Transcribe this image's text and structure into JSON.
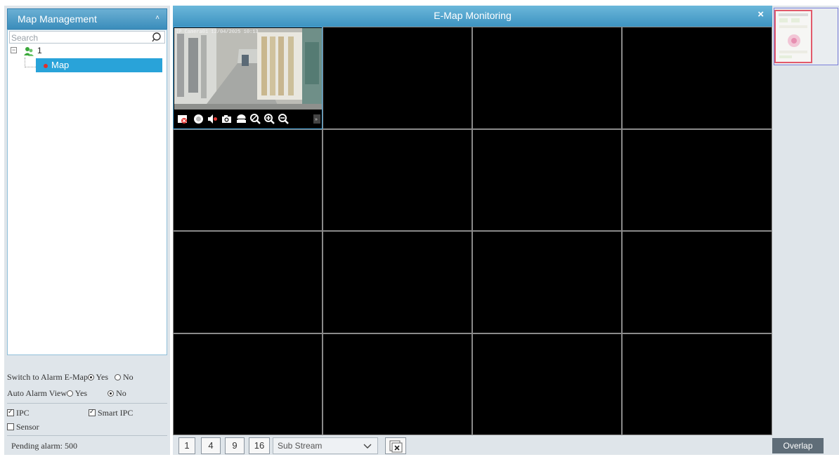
{
  "left_panel": {
    "title": "Map Management",
    "search": {
      "placeholder": "Search"
    },
    "tree": {
      "root_label": "1",
      "expander": "⊟",
      "children": [
        {
          "label": "Map",
          "selected": true
        }
      ]
    },
    "options": {
      "switch_alarm_label": "Switch to Alarm E-Map",
      "switch_alarm_yes": "Yes",
      "switch_alarm_no": "No",
      "switch_alarm_selected": "Yes",
      "auto_alarm_label": "Auto Alarm View",
      "auto_alarm_yes": "Yes",
      "auto_alarm_no": "No",
      "auto_alarm_selected": "No"
    },
    "filters": {
      "ipc": {
        "label": "IPC",
        "checked": true
      },
      "smart_ipc": {
        "label": "Smart IPC",
        "checked": true
      },
      "sensor": {
        "label": "Sensor",
        "checked": false
      }
    },
    "pending_alarm": "Pending alarm: 500"
  },
  "main": {
    "title": "E-Map Monitoring",
    "close_icon": "×",
    "camera_overlay": "IP Camera01   12/04/2025 10:13",
    "camera_toolbar_icons": [
      "close-view-icon",
      "record-icon",
      "mute-icon",
      "snapshot-icon",
      "ptz-icon",
      "zoom-icon",
      "zoom-in-icon",
      "zoom-out-icon",
      "more-icon"
    ],
    "bottom_bar": {
      "layouts": [
        "1",
        "4",
        "9",
        "16"
      ],
      "stream": "Sub Stream"
    }
  },
  "right_panel": {
    "overlap_label": "Overlap"
  },
  "colors": {
    "header_blue": "#3d93c1",
    "selection_blue": "#29a3d9",
    "panel_bg": "#dfe5ea",
    "video_bg": "#000000",
    "minimap_border": "#7b7fd9",
    "minimap_view_border": "#e25a6b"
  }
}
